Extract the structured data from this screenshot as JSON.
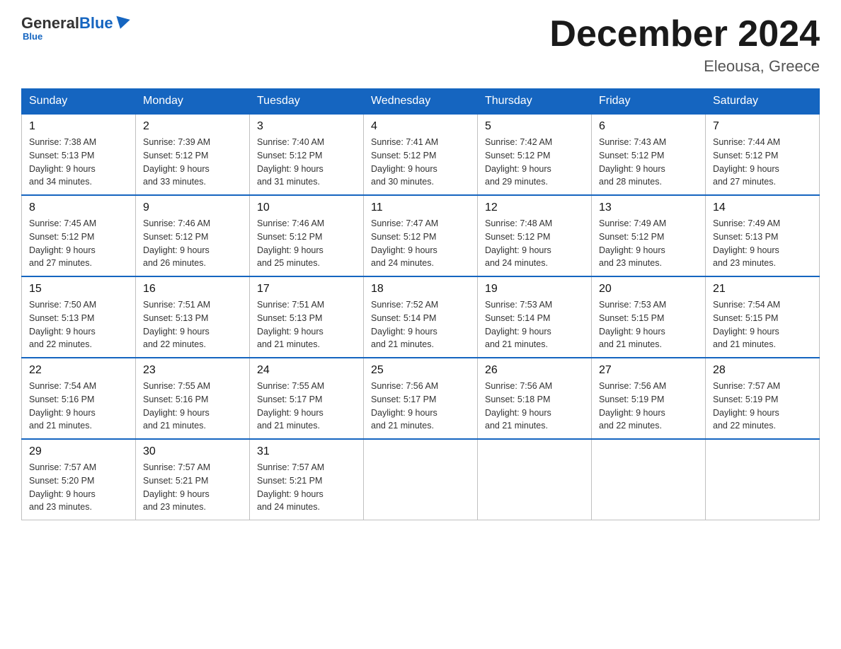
{
  "logo": {
    "general": "General",
    "blue": "Blue",
    "subtitle": "Blue"
  },
  "header": {
    "title": "December 2024",
    "location": "Eleousa, Greece"
  },
  "days_of_week": [
    "Sunday",
    "Monday",
    "Tuesday",
    "Wednesday",
    "Thursday",
    "Friday",
    "Saturday"
  ],
  "weeks": [
    [
      {
        "day": "1",
        "sunrise": "7:38 AM",
        "sunset": "5:13 PM",
        "daylight": "9 hours and 34 minutes."
      },
      {
        "day": "2",
        "sunrise": "7:39 AM",
        "sunset": "5:12 PM",
        "daylight": "9 hours and 33 minutes."
      },
      {
        "day": "3",
        "sunrise": "7:40 AM",
        "sunset": "5:12 PM",
        "daylight": "9 hours and 31 minutes."
      },
      {
        "day": "4",
        "sunrise": "7:41 AM",
        "sunset": "5:12 PM",
        "daylight": "9 hours and 30 minutes."
      },
      {
        "day": "5",
        "sunrise": "7:42 AM",
        "sunset": "5:12 PM",
        "daylight": "9 hours and 29 minutes."
      },
      {
        "day": "6",
        "sunrise": "7:43 AM",
        "sunset": "5:12 PM",
        "daylight": "9 hours and 28 minutes."
      },
      {
        "day": "7",
        "sunrise": "7:44 AM",
        "sunset": "5:12 PM",
        "daylight": "9 hours and 27 minutes."
      }
    ],
    [
      {
        "day": "8",
        "sunrise": "7:45 AM",
        "sunset": "5:12 PM",
        "daylight": "9 hours and 27 minutes."
      },
      {
        "day": "9",
        "sunrise": "7:46 AM",
        "sunset": "5:12 PM",
        "daylight": "9 hours and 26 minutes."
      },
      {
        "day": "10",
        "sunrise": "7:46 AM",
        "sunset": "5:12 PM",
        "daylight": "9 hours and 25 minutes."
      },
      {
        "day": "11",
        "sunrise": "7:47 AM",
        "sunset": "5:12 PM",
        "daylight": "9 hours and 24 minutes."
      },
      {
        "day": "12",
        "sunrise": "7:48 AM",
        "sunset": "5:12 PM",
        "daylight": "9 hours and 24 minutes."
      },
      {
        "day": "13",
        "sunrise": "7:49 AM",
        "sunset": "5:12 PM",
        "daylight": "9 hours and 23 minutes."
      },
      {
        "day": "14",
        "sunrise": "7:49 AM",
        "sunset": "5:13 PM",
        "daylight": "9 hours and 23 minutes."
      }
    ],
    [
      {
        "day": "15",
        "sunrise": "7:50 AM",
        "sunset": "5:13 PM",
        "daylight": "9 hours and 22 minutes."
      },
      {
        "day": "16",
        "sunrise": "7:51 AM",
        "sunset": "5:13 PM",
        "daylight": "9 hours and 22 minutes."
      },
      {
        "day": "17",
        "sunrise": "7:51 AM",
        "sunset": "5:13 PM",
        "daylight": "9 hours and 21 minutes."
      },
      {
        "day": "18",
        "sunrise": "7:52 AM",
        "sunset": "5:14 PM",
        "daylight": "9 hours and 21 minutes."
      },
      {
        "day": "19",
        "sunrise": "7:53 AM",
        "sunset": "5:14 PM",
        "daylight": "9 hours and 21 minutes."
      },
      {
        "day": "20",
        "sunrise": "7:53 AM",
        "sunset": "5:15 PM",
        "daylight": "9 hours and 21 minutes."
      },
      {
        "day": "21",
        "sunrise": "7:54 AM",
        "sunset": "5:15 PM",
        "daylight": "9 hours and 21 minutes."
      }
    ],
    [
      {
        "day": "22",
        "sunrise": "7:54 AM",
        "sunset": "5:16 PM",
        "daylight": "9 hours and 21 minutes."
      },
      {
        "day": "23",
        "sunrise": "7:55 AM",
        "sunset": "5:16 PM",
        "daylight": "9 hours and 21 minutes."
      },
      {
        "day": "24",
        "sunrise": "7:55 AM",
        "sunset": "5:17 PM",
        "daylight": "9 hours and 21 minutes."
      },
      {
        "day": "25",
        "sunrise": "7:56 AM",
        "sunset": "5:17 PM",
        "daylight": "9 hours and 21 minutes."
      },
      {
        "day": "26",
        "sunrise": "7:56 AM",
        "sunset": "5:18 PM",
        "daylight": "9 hours and 21 minutes."
      },
      {
        "day": "27",
        "sunrise": "7:56 AM",
        "sunset": "5:19 PM",
        "daylight": "9 hours and 22 minutes."
      },
      {
        "day": "28",
        "sunrise": "7:57 AM",
        "sunset": "5:19 PM",
        "daylight": "9 hours and 22 minutes."
      }
    ],
    [
      {
        "day": "29",
        "sunrise": "7:57 AM",
        "sunset": "5:20 PM",
        "daylight": "9 hours and 23 minutes."
      },
      {
        "day": "30",
        "sunrise": "7:57 AM",
        "sunset": "5:21 PM",
        "daylight": "9 hours and 23 minutes."
      },
      {
        "day": "31",
        "sunrise": "7:57 AM",
        "sunset": "5:21 PM",
        "daylight": "9 hours and 24 minutes."
      },
      null,
      null,
      null,
      null
    ]
  ]
}
